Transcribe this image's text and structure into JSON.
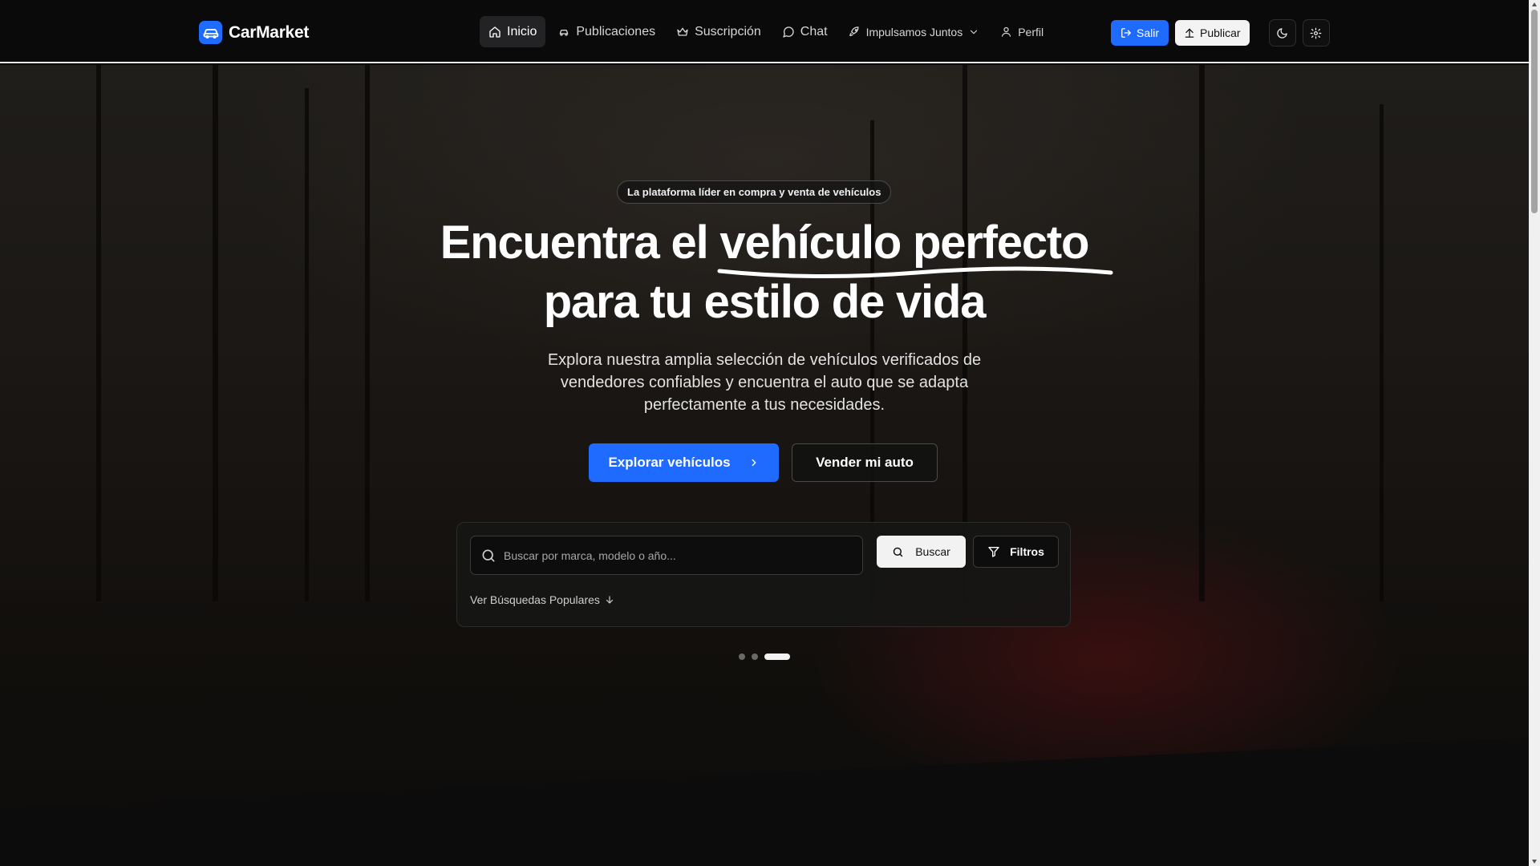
{
  "brand": {
    "name": "CarMarket"
  },
  "nav": {
    "items": [
      {
        "label": "Inicio",
        "icon": "home-icon",
        "active": true
      },
      {
        "label": "Publicaciones",
        "icon": "car-icon"
      },
      {
        "label": "Suscripción",
        "icon": "crown-icon"
      },
      {
        "label": "Chat",
        "icon": "chat-icon"
      },
      {
        "label": "Impulsamos Juntos",
        "icon": "rocket-icon"
      },
      {
        "label": "Perfil",
        "icon": "user-icon"
      }
    ],
    "salir_label": "Salir",
    "publicar_label": "Publicar"
  },
  "hero": {
    "badge": "La plataforma líder en compra y venta de vehículos",
    "headline_part1": "Encuentra el ",
    "headline_accent": "vehículo perfecto",
    "headline_part2": "para tu estilo de vida",
    "subtitle": "Explora nuestra amplia selección de vehículos verificados de vendedores confiables y encuentra el auto que se adapta perfectamente a tus necesidades.",
    "explore_label": "Explorar vehículos",
    "sell_label": "Vender mi auto"
  },
  "search": {
    "placeholder": "Buscar por marca, modelo o año...",
    "search_label": "Buscar",
    "filters_label": "Filtros",
    "popular_label": "Ver Búsquedas Populares"
  },
  "carousel": {
    "slides": 3,
    "active_index": 2
  },
  "colors": {
    "accent": "#1f6bff",
    "background": "#0a0a0a"
  }
}
